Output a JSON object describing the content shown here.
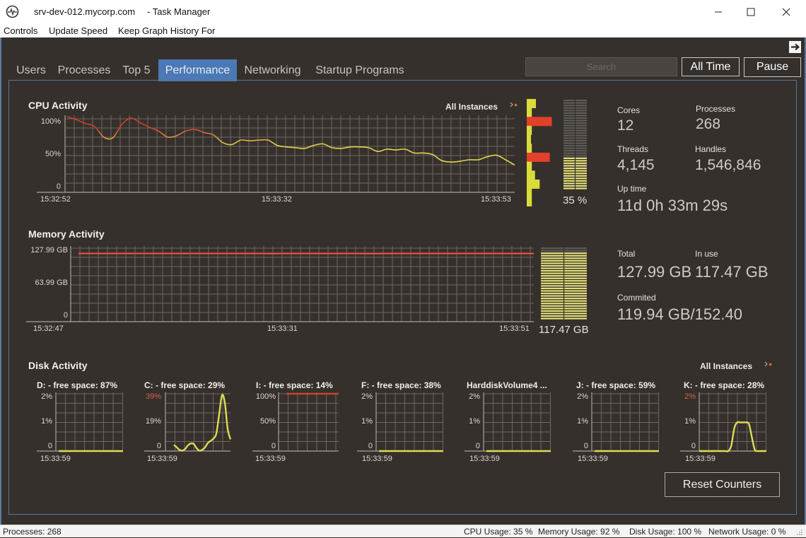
{
  "window": {
    "host": "srv-dev-012.mycorp.com",
    "title": "- Task Manager"
  },
  "menu": [
    "Controls",
    "Update Speed",
    "Keep Graph History For"
  ],
  "tabs": [
    {
      "label": "Users",
      "selected": false
    },
    {
      "label": "Processes",
      "selected": false
    },
    {
      "label": "Top 5",
      "selected": false
    },
    {
      "label": "Performance",
      "selected": true
    },
    {
      "label": "Networking",
      "selected": false
    },
    {
      "label": "Startup Programs",
      "selected": false
    }
  ],
  "toolbar": {
    "search_placeholder": "Search",
    "search_value": "",
    "time_range": "All Time",
    "pause": "Pause"
  },
  "colors": {
    "accent": "#4b79b5",
    "cpu_high": "#d63c2a",
    "cpu_mid": "#d9a040",
    "cpu_low": "#e3d54e",
    "memory_line": "#c8392b",
    "disk_line": "#dedc52",
    "disk_line_high": "#c9402e",
    "core_bar": "#d9dc3a",
    "core_bar_high": "#e2402a",
    "gauge_fill": "#e4e07a",
    "gauge_empty": "#5e5b58"
  },
  "cpu": {
    "title": "CPU Activity",
    "instances_label": "All Instances",
    "core_loads": [
      17,
      3,
      72,
      3,
      0,
      3,
      65,
      3,
      14,
      30,
      3,
      3
    ],
    "gauge_fill": 0.35,
    "gauge_label": "35 %",
    "stats": {
      "cores_label": "Cores",
      "cores": "12",
      "processes_label": "Processes",
      "processes": "268",
      "threads_label": "Threads",
      "threads": "4,145",
      "handles_label": "Handles",
      "handles": "1,546,846",
      "uptime_label": "Up time",
      "uptime": "11d 0h 33m 29s"
    }
  },
  "memory": {
    "title": "Memory Activity",
    "gauge_fill": 0.92,
    "gauge_label": "117.47 GB",
    "stats": {
      "total_label": "Total",
      "total": "127.99 GB",
      "in_use_label": "In use",
      "in_use": "117.47 GB",
      "committed_label": "Commited",
      "committed": "119.94 GB/152.40"
    }
  },
  "disk": {
    "title": "Disk Activity",
    "instances_label": "All Instances"
  },
  "reset_button": "Reset Counters",
  "status": {
    "processes": "Processes: 268",
    "cpu": "CPU Usage: 35 %",
    "memory": "Memory Usage: 92 %",
    "disk": "Disk Usage: 100 %",
    "network": "Network Usage: 0 %"
  },
  "chart_data": [
    {
      "id": "cpu",
      "type": "line",
      "title": "CPU Activity",
      "ylim": [
        0,
        100
      ],
      "yticks": [
        "100%",
        "50%",
        "0"
      ],
      "xticks": [
        "15:32:52",
        "15:33:32",
        "15:33:53"
      ],
      "grid": true,
      "values": [
        100,
        96,
        91,
        87,
        73,
        72,
        90,
        98,
        92,
        86,
        81,
        73,
        75,
        81,
        83,
        79,
        76,
        66,
        63,
        69,
        68,
        69,
        69,
        62,
        60,
        59,
        58,
        62,
        64,
        59,
        58,
        60,
        60,
        59,
        54,
        57,
        56,
        57,
        52,
        52,
        50,
        42,
        40,
        41,
        43,
        43,
        47,
        49,
        43,
        36
      ]
    },
    {
      "id": "memory",
      "type": "line",
      "title": "Memory Activity",
      "ylim": [
        0,
        127.99
      ],
      "yticks": [
        "127.99 GB",
        "63.99 GB",
        "0"
      ],
      "xticks": [
        "15:32:47",
        "15:33:31",
        "15:33:51"
      ],
      "grid": true,
      "values": [
        117.6,
        117.6,
        117.6,
        117.5,
        117.5,
        117.5,
        117.6,
        117.6,
        117.5,
        117.5,
        117.5,
        117.5,
        117.6,
        117.6,
        117.5,
        117.5,
        117.5,
        117.5,
        117.5,
        117.5,
        117.5,
        117.4,
        117.5,
        117.5,
        117.5,
        117.5,
        117.5,
        117.5,
        117.5,
        117.5,
        117.5,
        117.4,
        117.4,
        117.5,
        117.5,
        117.5,
        117.5,
        117.5,
        117.5,
        117.5,
        117.5,
        117.5,
        117.5,
        117.5,
        117.5,
        117.5,
        117.5,
        117.5,
        117.5,
        117.47
      ]
    },
    {
      "id": "disk-d",
      "type": "line",
      "title": "D: - free space: 87%",
      "ylim": [
        0,
        2
      ],
      "yticks": [
        "2%",
        "1%",
        "0"
      ],
      "max_highlight": false,
      "xticks": [
        "15:33:59"
      ],
      "grid": true,
      "values": [
        null,
        0,
        0,
        0,
        0,
        0,
        0,
        0,
        0,
        0,
        0,
        0,
        0,
        0,
        0,
        0,
        0,
        0,
        0,
        0,
        0,
        0,
        0,
        0
      ]
    },
    {
      "id": "disk-c",
      "type": "line",
      "title": "C: - free space: 29%",
      "ylim": [
        0,
        39
      ],
      "yticks": [
        "39%",
        "19%",
        "0"
      ],
      "max_highlight": true,
      "xticks": [
        "15:33:59"
      ],
      "grid": true,
      "values": [
        null,
        null,
        null,
        4.2,
        2.5,
        0.8,
        0.3,
        1.5,
        4.0,
        5.2,
        4.8,
        2.0,
        0.3,
        0.8,
        2.5,
        5.5,
        7.0,
        8.5,
        12,
        25,
        38,
        33,
        15,
        8
      ]
    },
    {
      "id": "disk-i",
      "type": "line",
      "title": "I: - free space: 14%",
      "ylim": [
        0,
        100
      ],
      "yticks": [
        "100%",
        "50%",
        "0"
      ],
      "max_highlight": false,
      "xticks": [
        "15:33:59"
      ],
      "grid": true,
      "values": [
        null,
        null,
        null,
        100,
        100,
        100,
        100,
        100,
        100,
        100,
        100,
        100,
        100,
        100,
        100,
        100,
        100,
        100,
        100,
        100,
        100,
        100,
        100,
        100
      ]
    },
    {
      "id": "disk-f",
      "type": "line",
      "title": "F: - free space: 38%",
      "ylim": [
        0,
        2
      ],
      "yticks": [
        "2%",
        "1%",
        "0"
      ],
      "max_highlight": false,
      "xticks": [
        "15:33:59"
      ],
      "grid": true,
      "values": [
        null,
        0,
        0,
        0,
        0,
        0,
        0,
        0,
        0,
        0,
        0,
        0,
        0,
        0,
        0,
        0,
        0,
        0,
        0,
        0,
        0,
        0,
        0,
        0
      ]
    },
    {
      "id": "disk-harddiskvolume4",
      "type": "line",
      "title": "HarddiskVolume4 ...",
      "ylim": [
        0,
        2
      ],
      "yticks": [
        "2%",
        "1%",
        "0"
      ],
      "max_highlight": false,
      "xticks": [
        "15:33:59"
      ],
      "grid": true,
      "values": [
        null,
        0,
        0,
        0,
        0,
        0,
        0,
        0,
        0,
        0,
        0,
        0,
        0,
        0,
        0,
        0,
        0,
        0,
        0,
        0,
        0,
        0,
        0,
        0
      ]
    },
    {
      "id": "disk-j",
      "type": "line",
      "title": "J: - free space: 59%",
      "ylim": [
        0,
        2
      ],
      "yticks": [
        "2%",
        "1%",
        "0"
      ],
      "max_highlight": false,
      "xticks": [
        "15:33:59"
      ],
      "grid": true,
      "values": [
        null,
        0,
        0,
        0,
        0,
        0,
        0,
        0,
        0,
        0,
        0,
        0,
        0,
        0,
        0,
        0,
        0,
        0,
        0,
        0,
        0,
        0,
        0,
        0
      ]
    },
    {
      "id": "disk-k",
      "type": "line",
      "title": "K: - free space: 28%",
      "ylim": [
        0,
        2
      ],
      "yticks": [
        "2%",
        "1%",
        "0"
      ],
      "max_highlight": true,
      "xticks": [
        "15:33:59"
      ],
      "grid": true,
      "values": [
        0,
        0,
        0,
        0,
        0,
        0,
        0,
        0,
        0,
        0,
        0,
        0.2,
        0.8,
        1.0,
        1.0,
        1.0,
        1.0,
        0.95,
        0.5,
        0.05,
        0,
        0,
        0,
        0
      ]
    }
  ]
}
